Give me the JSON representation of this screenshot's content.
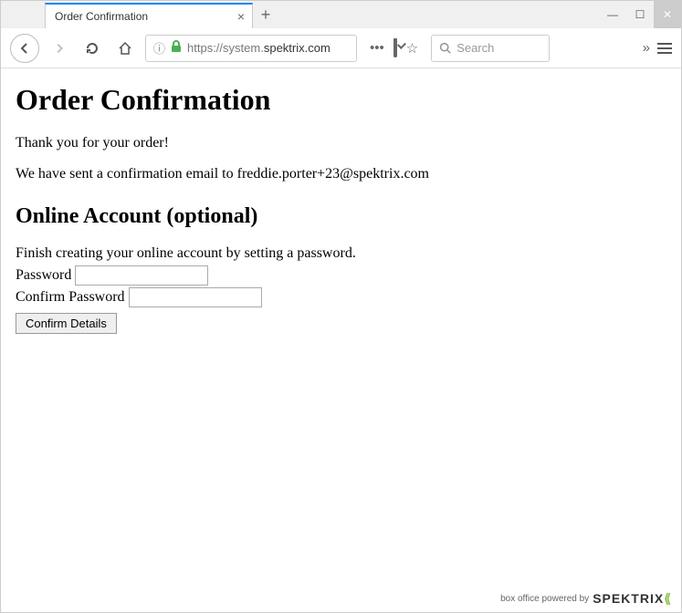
{
  "browser": {
    "tab_title": "Order Confirmation",
    "url_prefix": "https://",
    "url_host": "system.",
    "url_domain": "spektrix.com",
    "search_placeholder": "Search"
  },
  "page": {
    "heading": "Order Confirmation",
    "thank_you": "Thank you for your order!",
    "email_sent": "We have sent a confirmation email to freddie.porter+23@spektrix.com",
    "account_heading": "Online Account (optional)",
    "account_intro": "Finish creating your online account by setting a password.",
    "password_label": "Password",
    "confirm_password_label": "Confirm Password",
    "confirm_button": "Confirm Details"
  },
  "footer": {
    "text": "box office powered by",
    "brand": "SPEKTRIX"
  }
}
